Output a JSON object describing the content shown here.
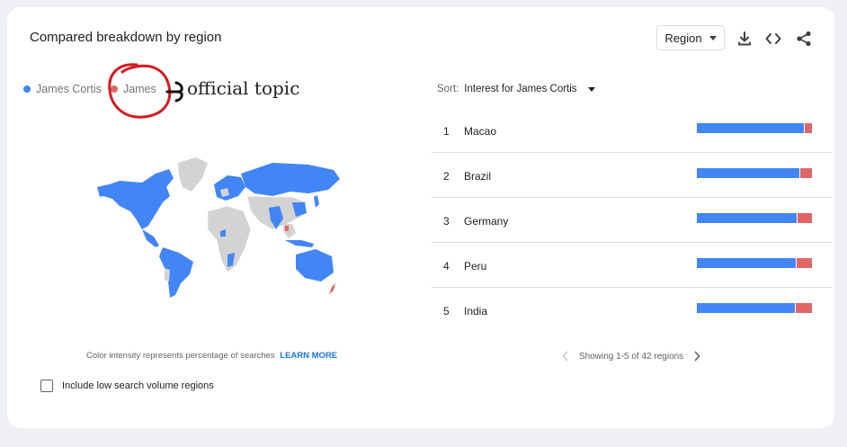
{
  "header": {
    "title": "Compared breakdown by region",
    "region_select": "Region",
    "icons": [
      "download-icon",
      "embed-code-icon",
      "share-icon"
    ]
  },
  "legend": [
    {
      "label": "James Cortis",
      "color": "#4285f4"
    },
    {
      "label": "James",
      "color": "#e06666"
    }
  ],
  "annotation": {
    "text": "official topic"
  },
  "map": {
    "caption": "Color intensity represents percentage of searches",
    "learn_more": "LEARN MORE"
  },
  "options": {
    "low_volume_label": "Include low search volume regions",
    "low_volume_checked": false
  },
  "sort": {
    "label": "Sort:",
    "value": "Interest for James Cortis"
  },
  "regions": [
    {
      "rank": "1",
      "name": "Macao",
      "share_blue": 0.93
    },
    {
      "rank": "2",
      "name": "Brazil",
      "share_blue": 0.89
    },
    {
      "rank": "3",
      "name": "Germany",
      "share_blue": 0.87
    },
    {
      "rank": "4",
      "name": "Peru",
      "share_blue": 0.86
    },
    {
      "rank": "5",
      "name": "India",
      "share_blue": 0.85
    }
  ],
  "pager": {
    "text": "Showing 1-5 of 42 regions"
  },
  "colors": {
    "blue": "#4285f4",
    "red": "#e06666",
    "map_gray": "#d3d3d3",
    "link": "#1a73e8"
  }
}
